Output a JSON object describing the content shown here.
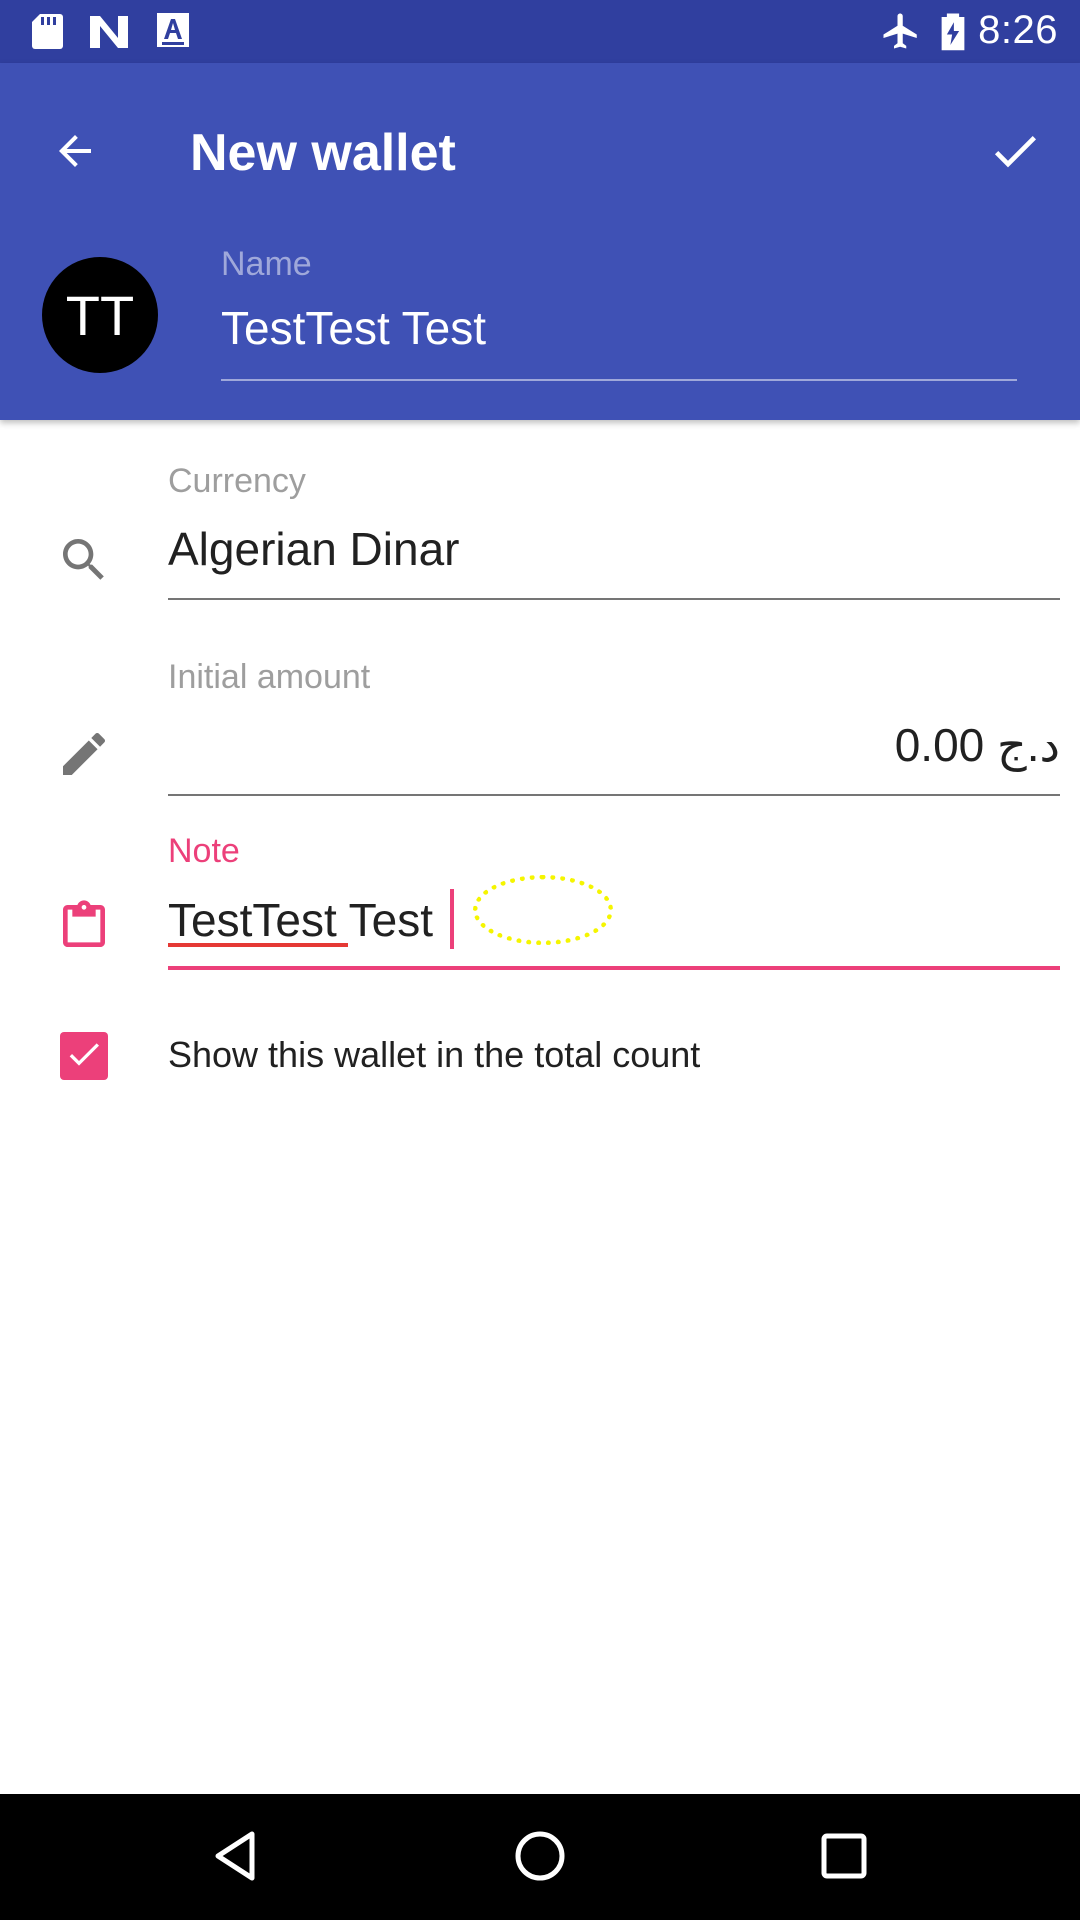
{
  "status_bar": {
    "time": "8:26",
    "left_icons": [
      "sd-card-icon",
      "n-logo-icon",
      "font-a-icon"
    ],
    "right_icons": [
      "airplane-mode-icon",
      "battery-charging-icon"
    ]
  },
  "app_bar": {
    "title": "New wallet",
    "back_icon": "arrow-left-icon",
    "done_icon": "check-icon",
    "color": "#3f51b5"
  },
  "wallet": {
    "avatar_initials": "TT",
    "name_label": "Name",
    "name_value": "TestTest Test"
  },
  "form": {
    "currency_label": "Currency",
    "currency_value": "Algerian Dinar",
    "amount_label": "Initial amount",
    "amount_value": "0.00 د.ج",
    "note_label": "Note",
    "note_value": "TestTest Test",
    "show_in_total_label": "Show this wallet in the total count",
    "show_in_total_checked": true
  },
  "accent_color": "#ec407a",
  "nav_bar": {
    "buttons": [
      "back-triangle-icon",
      "home-circle-icon",
      "recents-square-icon"
    ]
  }
}
